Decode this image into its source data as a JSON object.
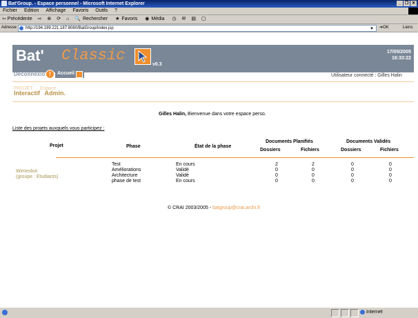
{
  "window": {
    "title": "Bat'Group. - Espace personnel - Microsoft Internet Explorer",
    "controls": [
      "_",
      "❒",
      "✕"
    ]
  },
  "menu": [
    "Fichier",
    "Edition",
    "Affichage",
    "Favoris",
    "Outils",
    "?"
  ],
  "toolbar": {
    "back": "⇦ Précédente",
    "forward": "⇨",
    "search": "Rechercher",
    "favorites": "Favoris",
    "media": "Média"
  },
  "address": {
    "label": "Adresse",
    "url": "http://194.199.221.187:8080/BatGroup/index.jsp",
    "ok": "OK",
    "links": "Liens"
  },
  "header": {
    "brand_bat": "Bat'",
    "brand_classic": "Classic",
    "version": "v0.3",
    "date": "17/05/2005",
    "time": "16:33:22",
    "deconnexion": "Déconnexion",
    "accueil": "Accueil Espace Perso",
    "user_connected": "Utilisateur connecté : Gilles Halin"
  },
  "tabs": {
    "interactif": "Interactif",
    "admin": "Admin.",
    "ghost_interactif": "PROJET",
    "ghost_admin": "Espace"
  },
  "welcome": {
    "name": "Gilles Halin,",
    "text": " Bienvenue dans votre espace perso."
  },
  "projects_title": "Liste des projets auxquels vous participez :",
  "table": {
    "headers": {
      "projet": "Projet",
      "phase": "Phase",
      "etat": "État de la phase",
      "docs_planifies": "Documents Planifiés",
      "docs_valides": "Documents Validés",
      "dossiers": "Dossiers",
      "fichiers": "Fichiers"
    },
    "project_name": "Wimesbot",
    "project_group": "(groupe : Etudiants)",
    "rows": [
      {
        "phase": "Test",
        "etat": "En cours",
        "pd": "2",
        "pf": "2",
        "vd": "0",
        "vf": "0"
      },
      {
        "phase": "Améliorations",
        "etat": "Validé",
        "pd": "0",
        "pf": "0",
        "vd": "0",
        "vf": "0"
      },
      {
        "phase": "Architecture",
        "etat": "Validé",
        "pd": "0",
        "pf": "0",
        "vd": "0",
        "vf": "0"
      },
      {
        "phase": "phase de test",
        "etat": "En cours",
        "pd": "0",
        "pf": "0",
        "vd": "0",
        "vf": "0"
      }
    ]
  },
  "footer": {
    "copyright": "© CRAI 2003/2005 - ",
    "email": "batgroup@crai.archi.fr"
  },
  "status": {
    "zone": "Internet"
  }
}
